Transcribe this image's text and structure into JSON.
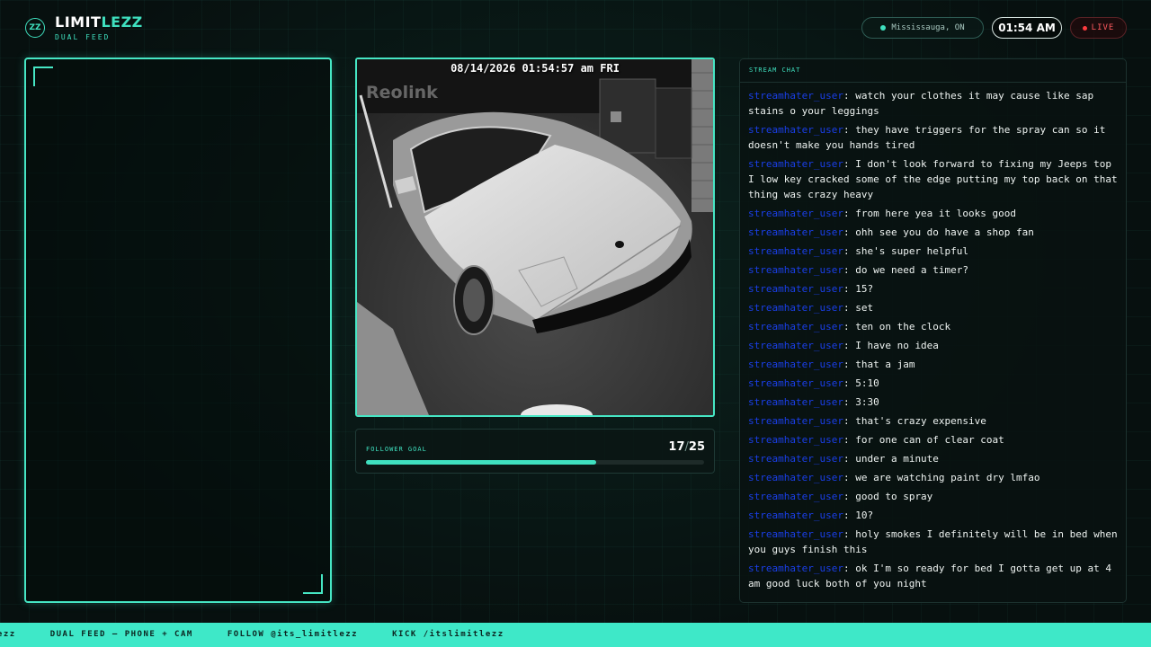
{
  "header": {
    "logo_text": "ZZ",
    "brand_main": "LIMIT",
    "brand_accent": "LEZZ",
    "subtitle": "DUAL FEED",
    "location": "Mississauga, ON",
    "time": "01:54 AM",
    "live_label": "LIVE"
  },
  "camera": {
    "timestamp": "08/14/2026 01:54:57 am FRI",
    "watermark": "Reolink"
  },
  "goal": {
    "label": "FOLLOWER GOAL",
    "current": "17",
    "separator": "/",
    "target": "25",
    "progress": 0.68
  },
  "chat": {
    "title": "STREAM CHAT",
    "messages": [
      {
        "user": "streamhater_user",
        "text": "watch your clothes it may cause like sap stains o your leggings"
      },
      {
        "user": "streamhater_user",
        "text": "they have triggers for the spray can so it doesn't make you hands tired"
      },
      {
        "user": "streamhater_user",
        "text": "I don't look forward to fixing my Jeeps top I low key cracked some of the edge putting my top back on that thing was crazy heavy"
      },
      {
        "user": "streamhater_user",
        "text": "from here yea it looks good"
      },
      {
        "user": "streamhater_user",
        "text": "ohh see you do have a shop fan"
      },
      {
        "user": "streamhater_user",
        "text": "she's super helpful"
      },
      {
        "user": "streamhater_user",
        "text": "do we need a timer?"
      },
      {
        "user": "streamhater_user",
        "text": "15?"
      },
      {
        "user": "streamhater_user",
        "text": "set"
      },
      {
        "user": "streamhater_user",
        "text": "ten on the clock"
      },
      {
        "user": "streamhater_user",
        "text": "I have no idea"
      },
      {
        "user": "streamhater_user",
        "text": "that a jam"
      },
      {
        "user": "streamhater_user",
        "text": "5:10"
      },
      {
        "user": "streamhater_user",
        "text": "3:30"
      },
      {
        "user": "streamhater_user",
        "text": "that's crazy expensive"
      },
      {
        "user": "streamhater_user",
        "text": "for one can of clear coat"
      },
      {
        "user": "streamhater_user",
        "text": "under a minute"
      },
      {
        "user": "streamhater_user",
        "text": "we are watching paint dry lmfao"
      },
      {
        "user": "streamhater_user",
        "text": "good to spray"
      },
      {
        "user": "streamhater_user",
        "text": "10?"
      },
      {
        "user": "streamhater_user",
        "text": "holy smokes I definitely will be in bed when you guys finish this"
      },
      {
        "user": "streamhater_user",
        "text": "ok I'm so ready for bed I gotta get up at 4 am good luck both of you night"
      }
    ]
  },
  "ticker": {
    "items": [
      "lezz",
      "DUAL FEED — PHONE + CAM",
      "FOLLOW @its_limitlezz",
      "KICK /itslimitlezz"
    ]
  },
  "colors": {
    "accent": "#3fe0bf",
    "username": "#1a3fe8",
    "live": "#ff5a5f",
    "ticker_bg": "#3ee8c8"
  }
}
